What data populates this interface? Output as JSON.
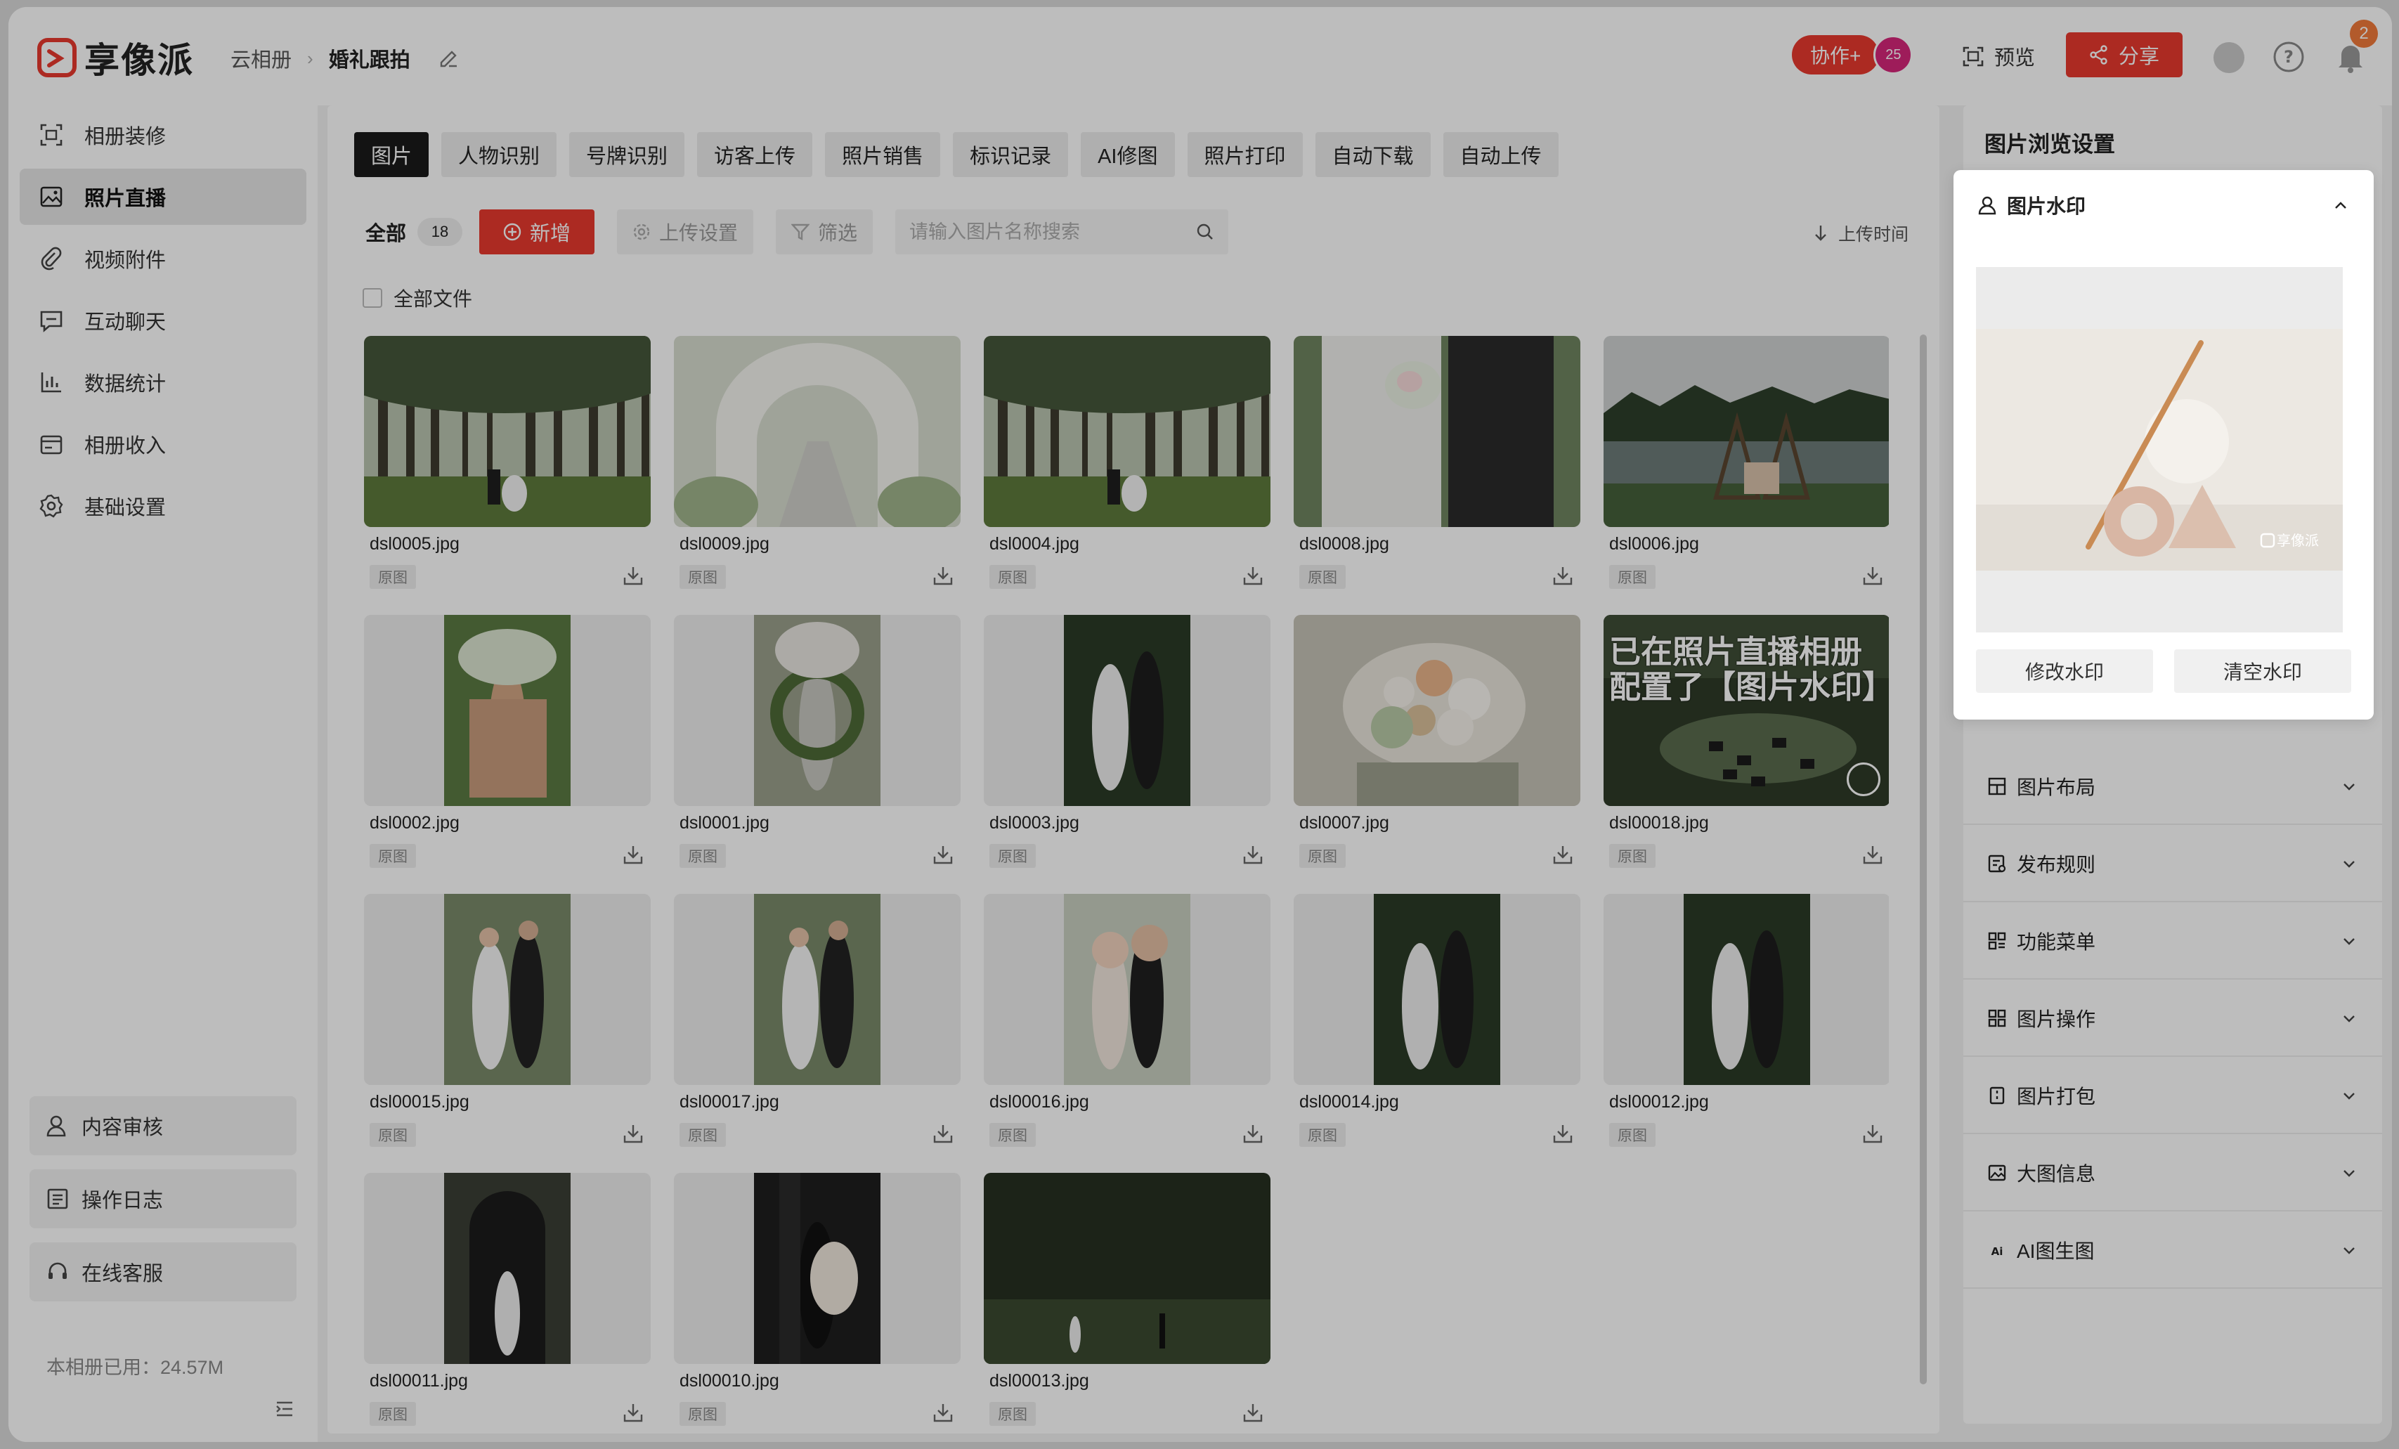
{
  "app": {
    "logo_text": "享像派"
  },
  "breadcrumb": {
    "root": "云相册",
    "current": "婚礼跟拍"
  },
  "header": {
    "collab_label": "协作+",
    "collab_count": "25",
    "preview_label": "预览",
    "share_label": "分享",
    "notification_count": "2"
  },
  "sidebar": {
    "items": [
      {
        "label": "相册装修",
        "icon": "frame-icon"
      },
      {
        "label": "照片直播",
        "icon": "image-icon"
      },
      {
        "label": "视频附件",
        "icon": "paperclip-icon"
      },
      {
        "label": "互动聊天",
        "icon": "chat-icon"
      },
      {
        "label": "数据统计",
        "icon": "chart-icon"
      },
      {
        "label": "相册收入",
        "icon": "wallet-icon"
      },
      {
        "label": "基础设置",
        "icon": "gear-icon"
      }
    ],
    "active_index": 1,
    "bottom": [
      {
        "label": "内容审核",
        "icon": "user-check-icon"
      },
      {
        "label": "操作日志",
        "icon": "log-icon"
      },
      {
        "label": "在线客服",
        "icon": "headset-icon"
      }
    ],
    "storage_text": "本相册已用：24.57M"
  },
  "main": {
    "tabs": [
      "图片",
      "人物识别",
      "号牌识别",
      "访客上传",
      "照片销售",
      "标识记录",
      "AI修图",
      "照片打印",
      "自动下载",
      "自动上传"
    ],
    "active_tab": 0,
    "toolbar": {
      "all_label": "全部",
      "all_count": "18",
      "add_label": "新增",
      "upload_settings_label": "上传设置",
      "filter_label": "筛选",
      "search_placeholder": "请输入图片名称搜索",
      "sort_label": "上传时间"
    },
    "select_all_label": "全部文件",
    "tag_label": "原图",
    "photos": [
      {
        "name": "dsl0005.jpg",
        "style": "forest"
      },
      {
        "name": "dsl0009.jpg",
        "style": "arch"
      },
      {
        "name": "dsl0004.jpg",
        "style": "forest"
      },
      {
        "name": "dsl0008.jpg",
        "style": "couple-close"
      },
      {
        "name": "dsl0006.jpg",
        "style": "lake"
      },
      {
        "name": "dsl0002.jpg",
        "style": "portrait-green"
      },
      {
        "name": "dsl0001.jpg",
        "style": "portrait-wreath"
      },
      {
        "name": "dsl0003.jpg",
        "style": "portrait-couple-dark"
      },
      {
        "name": "dsl0007.jpg",
        "style": "bouquet"
      },
      {
        "name": "dsl00018.jpg",
        "style": "aerial"
      },
      {
        "name": "dsl00015.jpg",
        "style": "portrait-couple"
      },
      {
        "name": "dsl00017.jpg",
        "style": "portrait-couple"
      },
      {
        "name": "dsl00016.jpg",
        "style": "portrait-couple-close"
      },
      {
        "name": "dsl00014.jpg",
        "style": "portrait-couple-dark"
      },
      {
        "name": "dsl00012.jpg",
        "style": "portrait-couple-dark"
      },
      {
        "name": "dsl00011.jpg",
        "style": "portrait-dark-door"
      },
      {
        "name": "dsl00010.jpg",
        "style": "portrait-suit"
      },
      {
        "name": "dsl00013.jpg",
        "style": "dark-forest"
      }
    ],
    "overlay_text_line1": "已在照片直播相册",
    "overlay_text_line2": "配置了【图片水印】"
  },
  "panel": {
    "title": "图片浏览设置",
    "watermark": {
      "label": "图片水印",
      "edit_label": "修改水印",
      "clear_label": "清空水印",
      "watermark_text": "享像派"
    },
    "sections": [
      {
        "label": "图片布局",
        "icon": "layout-icon"
      },
      {
        "label": "发布规则",
        "icon": "rules-icon"
      },
      {
        "label": "功能菜单",
        "icon": "menu-grid-icon"
      },
      {
        "label": "图片操作",
        "icon": "grid-icon"
      },
      {
        "label": "图片打包",
        "icon": "package-icon"
      },
      {
        "label": "大图信息",
        "icon": "image-info-icon"
      },
      {
        "label": "AI图生图",
        "icon": "ai-icon"
      }
    ]
  },
  "colors": {
    "accent": "#e8392e",
    "collab_badge": "#d6277a",
    "notification": "#f07a3a"
  }
}
